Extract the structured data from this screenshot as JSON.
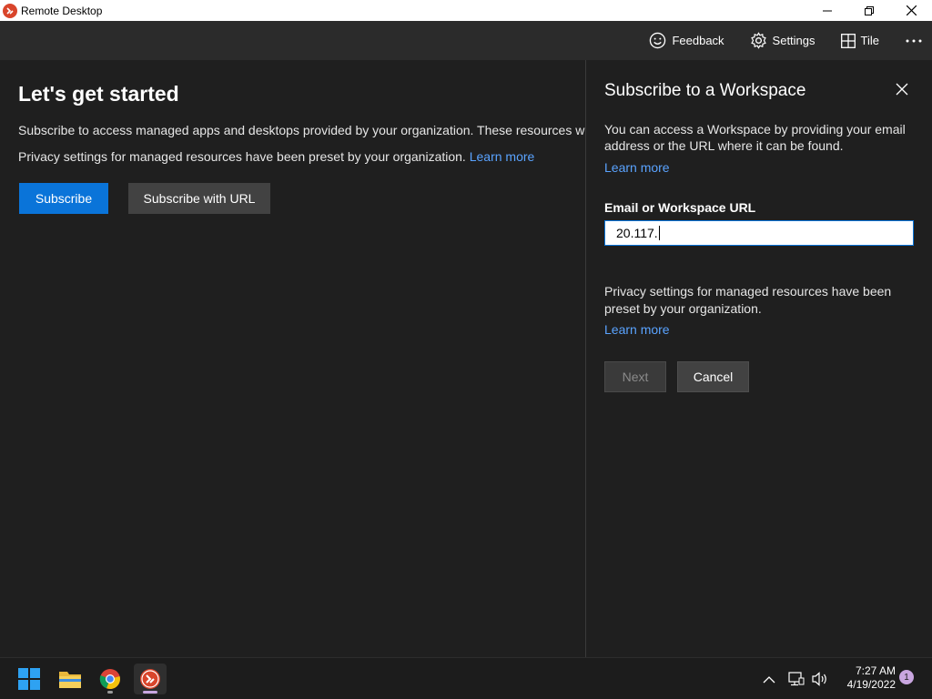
{
  "window": {
    "title": "Remote Desktop",
    "controls": [
      "minimize-icon",
      "restore-icon",
      "close-icon"
    ]
  },
  "toolbar": {
    "feedback_label": "Feedback",
    "settings_label": "Settings",
    "tile_label": "Tile",
    "more_icon": "more-horizontal-icon"
  },
  "main": {
    "heading": "Let's get started",
    "subscribe_text": "Subscribe to access managed apps and desktops provided by your organization. These resources will",
    "privacy_text": "Privacy settings for managed resources have been preset by your organization.",
    "learn_more": "Learn more",
    "subscribe_button": "Subscribe",
    "subscribe_url_button": "Subscribe with URL"
  },
  "panel": {
    "title": "Subscribe to a Workspace",
    "description": "You can access a Workspace by providing your email address or the URL where it can be found.",
    "learn_more": "Learn more",
    "field_label": "Email or Workspace URL",
    "field_value": "20.117.",
    "privacy_text": "Privacy settings for managed resources have been preset by your organization.",
    "learn_more_2": "Learn more",
    "next_button": "Next",
    "cancel_button": "Cancel"
  },
  "taskbar": {
    "apps": [
      "windows-start-icon",
      "file-explorer-icon",
      "chrome-icon",
      "remote-desktop-icon"
    ],
    "time": "7:27 AM",
    "date": "4/19/2022",
    "notification_count": "1"
  },
  "colors": {
    "accent": "#0a74d9",
    "link": "#5aa3ff",
    "background": "#1f1f1f"
  }
}
